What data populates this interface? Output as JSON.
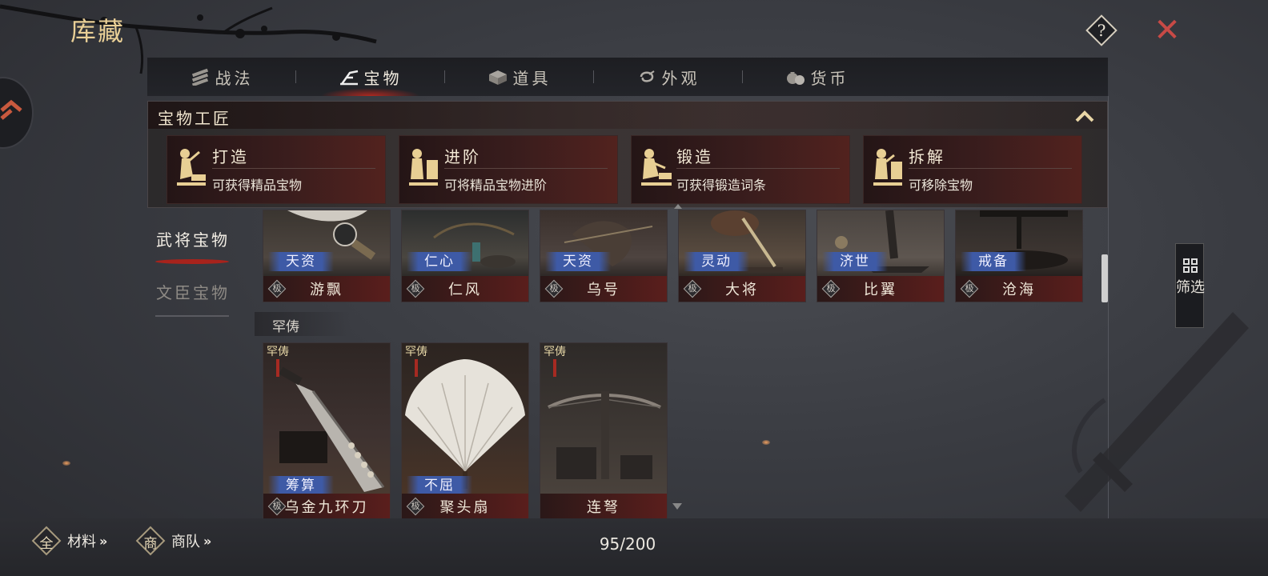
{
  "header": {
    "title": "库藏",
    "help_icon": "question-icon",
    "close_icon": "close-icon"
  },
  "tabs": [
    {
      "label": "战法",
      "icon": "scroll-bundle-icon",
      "active": false
    },
    {
      "label": "宝物",
      "icon": "treasure-icon",
      "active": true
    },
    {
      "label": "道具",
      "icon": "chest-icon",
      "active": false
    },
    {
      "label": "外观",
      "icon": "appearance-icon",
      "active": false
    },
    {
      "label": "货币",
      "icon": "money-bag-icon",
      "active": false
    }
  ],
  "craft": {
    "title": "宝物工匠",
    "collapse_icon": "chevron-up-icon",
    "actions": [
      {
        "name": "打造",
        "desc": "可获得精品宝物",
        "icon": "blacksmith-figure-icon"
      },
      {
        "name": "进阶",
        "desc": "可将精品宝物进阶",
        "icon": "blacksmith-figure-icon"
      },
      {
        "name": "锻造",
        "desc": "可获得锻造词条",
        "icon": "blacksmith-figure-icon"
      },
      {
        "name": "拆解",
        "desc": "可移除宝物",
        "icon": "blacksmith-figure-icon"
      }
    ]
  },
  "categories": [
    {
      "label": "武将宝物",
      "active": true
    },
    {
      "label": "文臣宝物",
      "active": false
    }
  ],
  "top_row": [
    {
      "tag": "天资",
      "name": "游飘",
      "quality": "极"
    },
    {
      "tag": "仁心",
      "name": "仁风",
      "quality": "极"
    },
    {
      "tag": "天资",
      "name": "乌号",
      "quality": "极"
    },
    {
      "tag": "灵动",
      "name": "大将",
      "quality": "极"
    },
    {
      "tag": "济世",
      "name": "比翼",
      "quality": "极"
    },
    {
      "tag": "戒备",
      "name": "沧海",
      "quality": "极"
    }
  ],
  "rare_section": {
    "label": "罕俦",
    "badge": "罕俦",
    "items": [
      {
        "tag": "筹算",
        "name": "乌金九环刀",
        "quality": "极"
      },
      {
        "tag": "不屈",
        "name": "聚头扇",
        "quality": "极"
      },
      {
        "tag": "",
        "name": "连弩",
        "quality": ""
      }
    ]
  },
  "filter": {
    "label": "筛选",
    "icon": "grid-filter-icon"
  },
  "bottom": {
    "materials": {
      "icon_char": "全",
      "label": "材料"
    },
    "caravan": {
      "icon_char": "商",
      "label": "商队"
    },
    "more": "»",
    "capacity": "95/200"
  },
  "colors": {
    "title_gold": "#e9cf96",
    "close_red": "#c84a46",
    "tag_blue": "#3e5aa6",
    "name_bar_red": "#5a1e1c",
    "active_glow": "#c8281e"
  }
}
